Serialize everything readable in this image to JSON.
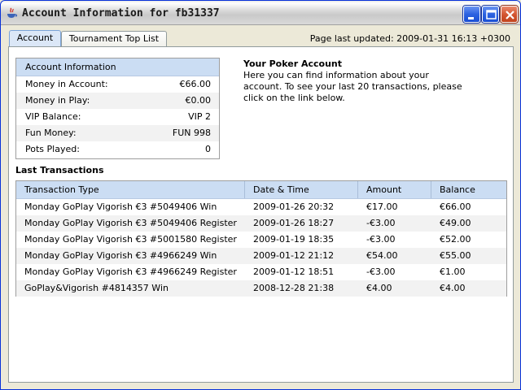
{
  "window": {
    "title": "Account Information for fb31337",
    "app_icon": "java-cup-icon",
    "controls": {
      "minimize": "minimize-icon",
      "maximize": "maximize-icon",
      "close": "close-icon"
    }
  },
  "tabs": [
    {
      "label": "Account",
      "active": true
    },
    {
      "label": "Tournament Top List",
      "active": false
    }
  ],
  "last_updated": "Page last updated: 2009-01-31 16:13 +0300",
  "account_info": {
    "header": "Account Information",
    "rows": [
      {
        "label": "Money in Account:",
        "value": "€66.00"
      },
      {
        "label": "Money in Play:",
        "value": "€0.00"
      },
      {
        "label": "VIP Balance:",
        "value": "VIP 2"
      },
      {
        "label": "Fun Money:",
        "value": "FUN 998"
      },
      {
        "label": "Pots Played:",
        "value": "0"
      }
    ]
  },
  "poker_account": {
    "title": "Your Poker Account",
    "description": "Here you can find information about your account. To see your last 20 transactions, please click on the link below."
  },
  "transactions": {
    "label": "Last Transactions",
    "columns": [
      "Transaction Type",
      "Date & Time",
      "Amount",
      "Balance"
    ],
    "rows": [
      [
        "Monday GoPlay Vigorish €3 #5049406 Win",
        "2009-01-26 20:32",
        "€17.00",
        "€66.00"
      ],
      [
        "Monday GoPlay Vigorish €3 #5049406 Register",
        "2009-01-26 18:27",
        "-€3.00",
        "€49.00"
      ],
      [
        "Monday GoPlay Vigorish €3 #5001580 Register",
        "2009-01-19 18:35",
        "-€3.00",
        "€52.00"
      ],
      [
        "Monday GoPlay Vigorish €3 #4966249 Win",
        "2009-01-12 21:12",
        "€54.00",
        "€55.00"
      ],
      [
        "Monday GoPlay Vigorish €3 #4966249 Register",
        "2009-01-12 18:51",
        "-€3.00",
        "€1.00"
      ],
      [
        "GoPlay&Vigorish #4814357 Win",
        "2008-12-28 21:38",
        "€4.00",
        "€4.00"
      ]
    ]
  }
}
